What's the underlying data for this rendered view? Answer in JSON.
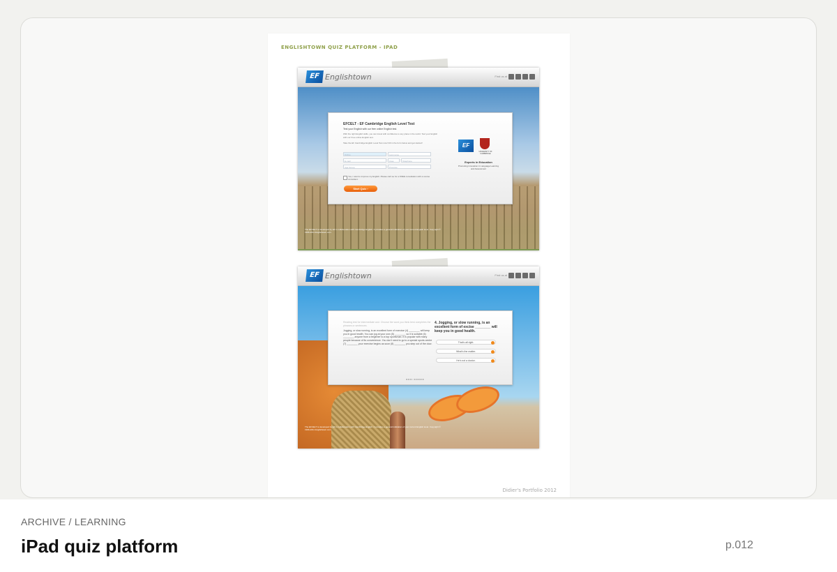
{
  "sheet": {
    "title": "ENGLISHTOWN QUIZ PLATFORM - IPAD",
    "footer": "Didier's Portfolio 2012"
  },
  "screen_header": {
    "logo_mark": "EF",
    "logo_text": "Englishtown",
    "find_us": "Find us at"
  },
  "screen1": {
    "title": "EFCELT - EF Cambridge English Level Test",
    "subtitle": "Test your English with our free online English test.",
    "intro": "With the right English skills, you can travel with confidence to any place in the world. Test your English with our Free online English test.",
    "instructions": "Take the EF Cambridge English Level Test now! Fill in the form below and get started!",
    "fields": {
      "first_name": "Online",
      "last_name": "Last name",
      "email": "E-mail",
      "prefix": "Area",
      "telephone": "Telephone",
      "age": "Age Group",
      "province": "Province"
    },
    "opt_in": "Yes, I want to improve my English. Please call me for a FREE consultation with a course consultant.",
    "start_button": "Start Quiz",
    "badge_mark": "EF",
    "university": "UNIVERSITY OF CAMBRIDGE",
    "experts_title": "Experts in Education",
    "experts_sub": "Promoting innovation in Language Learning and Assessment",
    "footer": "The EFCELT is developed by EF in collaboration with Cambridge English. It provides a general indication of your current English level. Copyright © 1996-2011 Englishtown.com."
  },
  "screen2": {
    "passage_intro": "Reading test for intermediate and. Choose the word you think best completes the phrases or sentences.",
    "passage": "Jogging, or slow running, is an excellent form of exercise (4) ________ will keep you in good health. You can jog at your own (5) ________ so it is suitable (6) ________ anyone from a beginner to a top sportsman. It is popular with many people because of its convenience. You don't need to go to a special sports centre (7) ________ your exercise begins as soon (8) ________ you step out of the door.",
    "question": "4. Jogging, or slow running, is an excellent form of excise ________ will keep you in good health.",
    "answers": [
      "That's all right.",
      "What's the matter.",
      "He's not a doctor."
    ],
    "pager": "●●●○●●●●●",
    "footer": "The EFCELT is developed by EF in collaboration with Cambridge English. It provides a general indication of your current English level. Copyright © 1996-2011 Englishtown.com."
  },
  "caption": {
    "breadcrumb": "ARCHIVE / LEARNING",
    "title": "iPad quiz platform",
    "page": "p.012"
  }
}
